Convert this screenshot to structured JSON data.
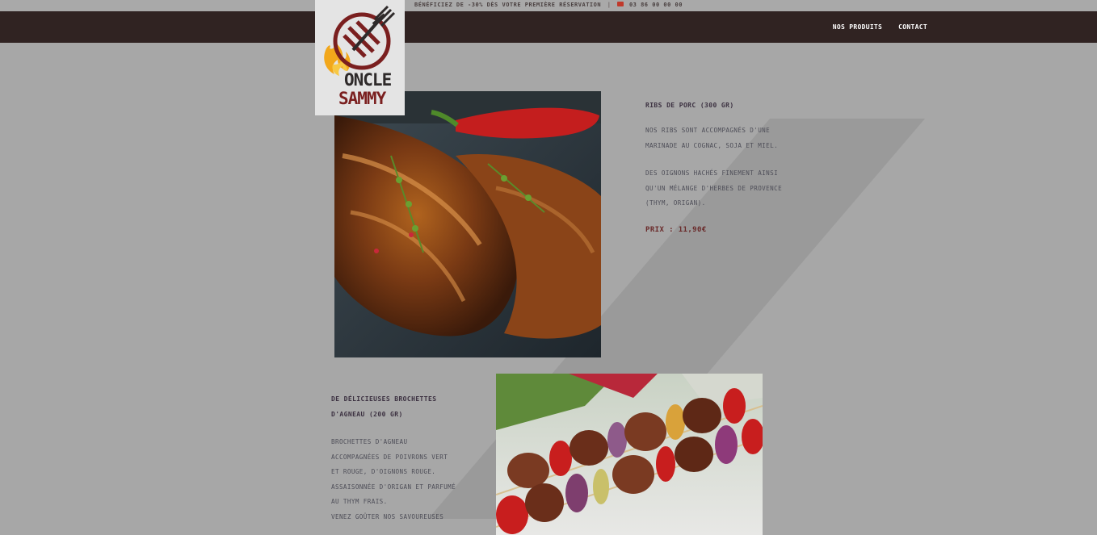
{
  "promo": {
    "text": "BÉNÉFICIEZ DE -30% DÈS VOTRE PREMIÈRE RÉSERVATION",
    "separator": "|",
    "phone": "03 86 00 00 00",
    "phone_icon": "phone-icon"
  },
  "nav": {
    "items": [
      {
        "label": "NOS PRODUITS"
      },
      {
        "label": "CONTACT"
      }
    ]
  },
  "logo": {
    "line1": "ONCLE",
    "line2": "SAMMY",
    "colors": {
      "red": "#7a1f1f",
      "dark": "#2e2a2a",
      "flame": "#f2a71b"
    }
  },
  "products": [
    {
      "title": "RIBS DE PORC (300 GR)",
      "desc1": [
        "NOS RIBS SONT ACCOMPAGNÉS D'UNE",
        "MARINADE AU COGNAC, SOJA ET MIEL."
      ],
      "desc2": [
        "DES OIGNONS HACHÉS FINEMENT AINSI",
        "QU'UN MÉLANGE D'HERBES DE PROVENCE",
        "(THYM, ORIGAN)."
      ],
      "price": "PRIX : 11,90€"
    },
    {
      "title": [
        "DE DÉLICIEUSES BROCHETTES",
        "D'AGNEAU (200 GR)"
      ],
      "desc1": [
        "BROCHETTES D'AGNEAU",
        "ACCOMPAGNÉES DE POIVRONS VERT",
        "ET ROUGE, D'OIGNONS ROUGE.",
        "ASSAISONNÉE D'ORIGAN ET PARFUMÉ",
        "AU THYM FRAIS.",
        "VENEZ GOÛTER NOS SAVOUREUSES"
      ]
    }
  ],
  "colors": {
    "background": "#a7a7a7",
    "navbar": "#302322",
    "price": "#6a2a2a"
  }
}
